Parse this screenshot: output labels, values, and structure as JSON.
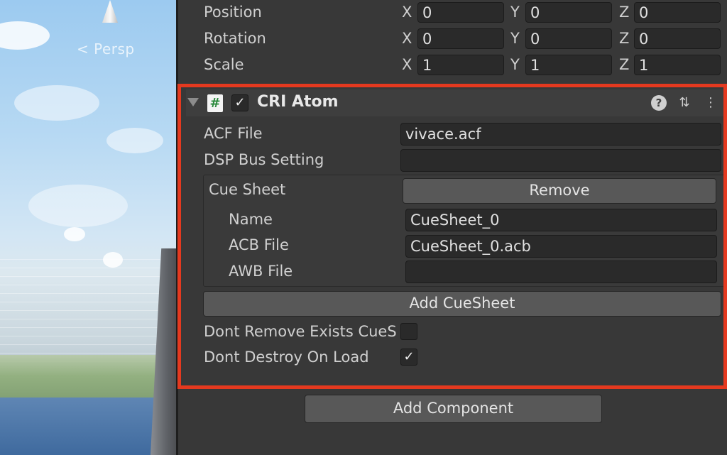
{
  "scene": {
    "view_label": "< Persp"
  },
  "transform": {
    "position": {
      "label": "Position",
      "x": "0",
      "y": "0",
      "z": "0"
    },
    "rotation": {
      "label": "Rotation",
      "x": "0",
      "y": "0",
      "z": "0"
    },
    "scale": {
      "label": "Scale",
      "x": "1",
      "y": "1",
      "z": "1"
    },
    "axis_labels": {
      "x": "X",
      "y": "Y",
      "z": "Z"
    }
  },
  "component": {
    "title": "CRI Atom",
    "script_icon": "#",
    "enabled_check": "✓",
    "icons": {
      "help": "?",
      "presets": "⇅",
      "menu": "⋮"
    },
    "acf_file": {
      "label": "ACF File",
      "value": "vivace.acf"
    },
    "dsp_bus": {
      "label": "DSP Bus Setting",
      "value": ""
    },
    "cue_sheet": {
      "label": "Cue Sheet",
      "remove_button": "Remove",
      "name": {
        "label": "Name",
        "value": "CueSheet_0"
      },
      "acb_file": {
        "label": "ACB File",
        "value": "CueSheet_0.acb"
      },
      "awb_file": {
        "label": "AWB File",
        "value": ""
      }
    },
    "add_cuesheet_button": "Add CueSheet",
    "dont_remove": {
      "label": "Dont Remove Exists CueS",
      "checked": ""
    },
    "dont_destroy": {
      "label": "Dont Destroy On Load",
      "checked": "✓"
    }
  },
  "add_component_button": "Add Component",
  "colors": {
    "highlight": "#e4391f",
    "panel": "#383838"
  }
}
